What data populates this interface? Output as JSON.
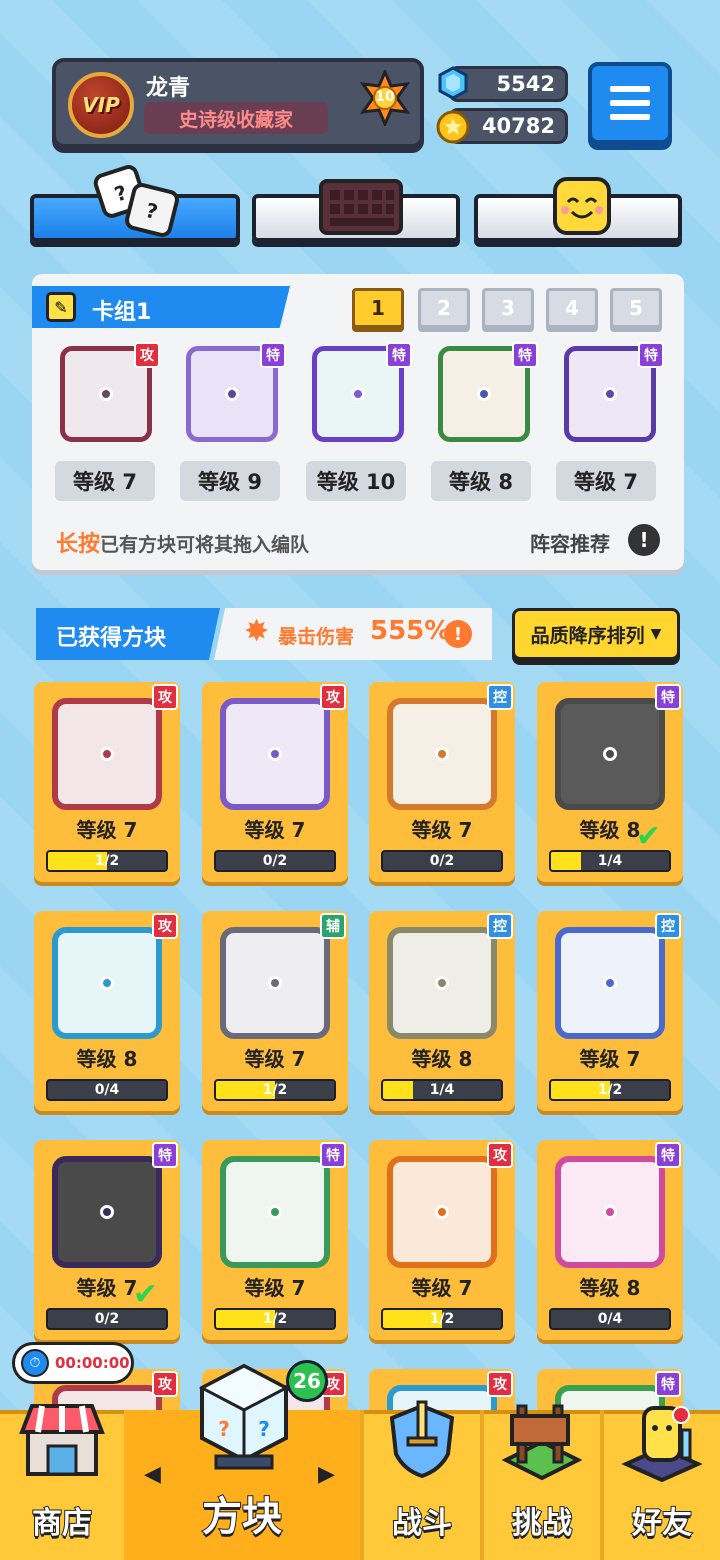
{
  "profile": {
    "name": "龙青",
    "title": "史诗级收藏家",
    "vip_label": "VIP",
    "rank_level": "10"
  },
  "resources": {
    "gems": "5542",
    "coins": "40782"
  },
  "colors": {
    "accent_blue": "#1f8af0",
    "card_orange": "#ffbd3c",
    "attack_red": "#e22e3e",
    "special_purple": "#8b3fd9",
    "control_blue": "#2d8fe6",
    "support_green": "#2aa46a"
  },
  "deck": {
    "title": "卡组1",
    "numbers": [
      "1",
      "2",
      "3",
      "4",
      "5"
    ],
    "active_index": 0,
    "cards": [
      {
        "tag": "攻",
        "level": "等级 7"
      },
      {
        "tag": "特",
        "level": "等级 9"
      },
      {
        "tag": "特",
        "level": "等级 10"
      },
      {
        "tag": "特",
        "level": "等级 8"
      },
      {
        "tag": "特",
        "level": "等级 7"
      }
    ],
    "hint_highlight": "长按",
    "hint_rest": "已有方块可将其拖入编队",
    "recommend": "阵容推荐",
    "info": "!"
  },
  "obtained": {
    "label": "已获得方块",
    "crit_label": "暴击伤害",
    "crit_value": "555%",
    "sort_label": "品质降序排列",
    "sort_arrow": "▼"
  },
  "grid": [
    {
      "tag": "攻",
      "level": "等级 7",
      "progress": "1/2",
      "fill": 0.5
    },
    {
      "tag": "攻",
      "level": "等级 7",
      "progress": "0/2",
      "fill": 0
    },
    {
      "tag": "控",
      "level": "等级 7",
      "progress": "0/2",
      "fill": 0
    },
    {
      "tag": "特",
      "level": "等级 8",
      "progress": "1/4",
      "fill": 0.25,
      "in_deck": true
    },
    {
      "tag": "攻",
      "level": "等级 8",
      "progress": "0/4",
      "fill": 0
    },
    {
      "tag": "辅",
      "level": "等级 7",
      "progress": "1/2",
      "fill": 0.5
    },
    {
      "tag": "控",
      "level": "等级 8",
      "progress": "1/4",
      "fill": 0.25
    },
    {
      "tag": "控",
      "level": "等级 7",
      "progress": "1/2",
      "fill": 0.5
    },
    {
      "tag": "特",
      "level": "等级 7",
      "progress": "0/2",
      "fill": 0,
      "in_deck": true
    },
    {
      "tag": "特",
      "level": "等级 7",
      "progress": "1/2",
      "fill": 0.5
    },
    {
      "tag": "攻",
      "level": "等级 7",
      "progress": "1/2",
      "fill": 0.5
    },
    {
      "tag": "特",
      "level": "等级 8",
      "progress": "0/4",
      "fill": 0
    },
    {
      "tag": "攻"
    },
    {
      "tag": "攻"
    },
    {
      "tag": "攻"
    },
    {
      "tag": "特"
    }
  ],
  "timer": "00:00:00",
  "nav": {
    "shop": "商店",
    "blocks": "方块",
    "battle": "战斗",
    "challenge": "挑战",
    "friends": "好友",
    "blocks_badge": "26",
    "arrow_left": "◀",
    "arrow_right": "▶"
  }
}
